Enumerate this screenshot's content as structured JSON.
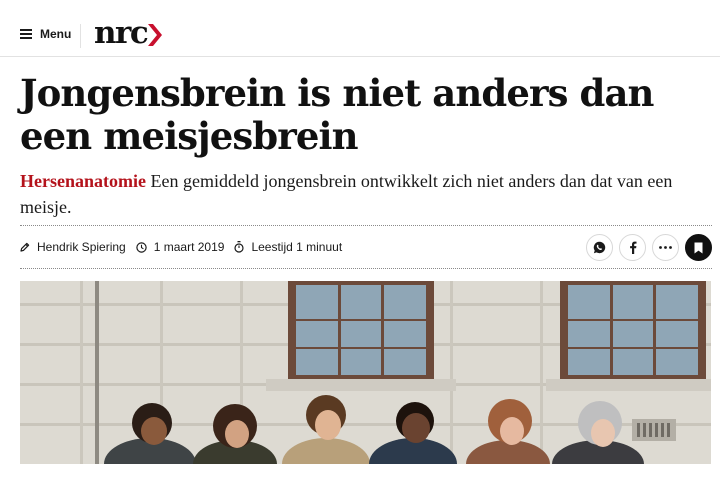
{
  "header": {
    "menu_label": "Menu",
    "logo_text": "nrc",
    "brand_color": "#c8102e"
  },
  "article": {
    "title": "Jongensbrein is niet anders dan een meisjesbrein",
    "category": "Hersenanatomie",
    "intro": "Een gemiddeld jongensbrein ontwikkelt zich niet anders dan dat van een meisje.",
    "author": "Hendrik Spiering",
    "date": "1 maart 2019",
    "reading_time": "Leestijd 1 minuut"
  },
  "icons": {
    "menu": "hamburger-icon",
    "author": "pen-icon",
    "date": "clock-icon",
    "reading_time": "stopwatch-icon",
    "share_whatsapp": "whatsapp-icon",
    "share_facebook": "facebook-icon",
    "more": "more-dots-icon",
    "bookmark": "bookmark-icon"
  },
  "colors": {
    "category": "#b4121b",
    "text": "#1a1a1a",
    "bookmark_bg": "#111111"
  }
}
